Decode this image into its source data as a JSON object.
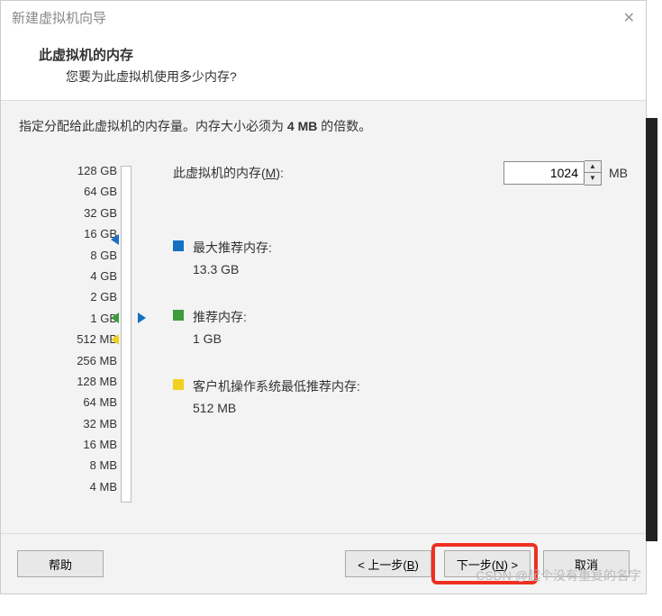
{
  "titlebar": {
    "title": "新建虚拟机向导"
  },
  "header": {
    "title": "此虚拟机的内存",
    "subtitle": "您要为此虚拟机使用多少内存?"
  },
  "instruction_prefix": "指定分配给此虚拟机的内存量。内存大小必须为 ",
  "instruction_bold": "4 MB",
  "instruction_suffix": " 的倍数。",
  "memory": {
    "label_prefix": "此虚拟机的内存(",
    "label_mnemonic": "M",
    "label_suffix": "):",
    "value": "1024",
    "unit": "MB"
  },
  "scale_labels": [
    "128 GB",
    "64 GB",
    "32 GB",
    "16 GB",
    "8 GB",
    "4 GB",
    "2 GB",
    "1 GB",
    "512 MB",
    "256 MB",
    "128 MB",
    "64 MB",
    "32 MB",
    "16 MB",
    "8 MB",
    "4 MB"
  ],
  "legend": {
    "max": {
      "label": "最大推荐内存:",
      "value": "13.3 GB"
    },
    "recommended": {
      "label": "推荐内存:",
      "value": "1 GB"
    },
    "min": {
      "label": "客户机操作系统最低推荐内存:",
      "value": "512 MB"
    }
  },
  "footer": {
    "help": "帮助",
    "back_prefix": "< 上一步(",
    "back_mn": "B",
    "back_suffix": ")",
    "next_prefix": "下一步(",
    "next_mn": "N",
    "next_suffix": ") >",
    "cancel": "取消"
  },
  "watermark": "CSDN @起个没有重复的名字"
}
